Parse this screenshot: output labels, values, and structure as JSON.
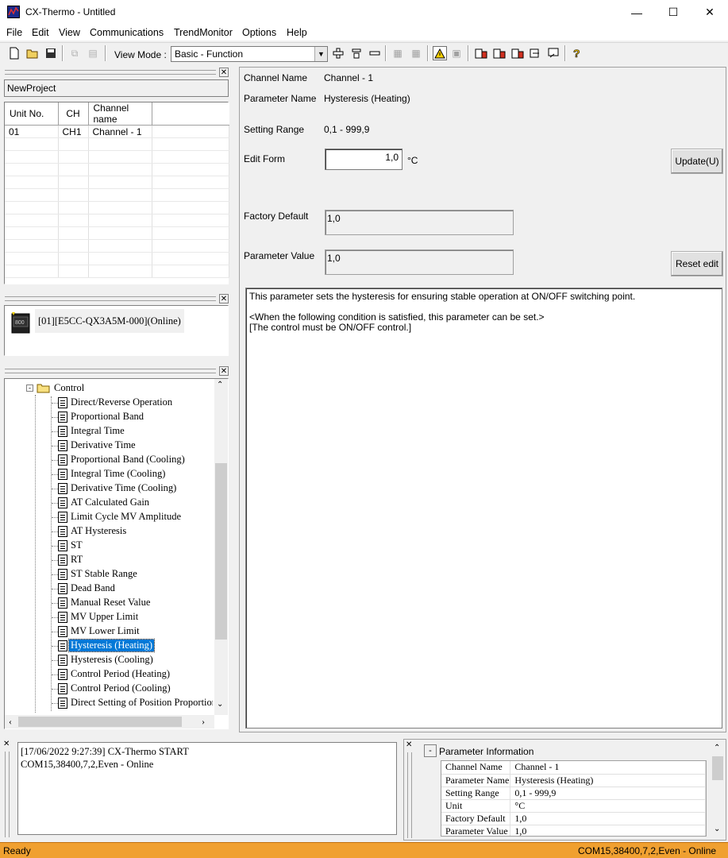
{
  "window": {
    "title": "CX-Thermo - Untitled",
    "minimize": "—",
    "maximize": "☐",
    "close": "✕"
  },
  "menu": [
    "File",
    "Edit",
    "View",
    "Communications",
    "TrendMonitor",
    "Options",
    "Help"
  ],
  "toolbar": {
    "view_mode_label": "View Mode :",
    "view_mode_value": "Basic - Function"
  },
  "project": {
    "name": "NewProject"
  },
  "unit_table": {
    "headers": [
      "Unit No.",
      "CH",
      "Channel name"
    ],
    "rows": [
      [
        "01",
        "CH1",
        "Channel - 1"
      ]
    ]
  },
  "device": {
    "label": "[01][E5CC-QX3A5M-000](Online)",
    "icon_text": "800"
  },
  "tree": {
    "folder": "Control",
    "items": [
      "Direct/Reverse Operation",
      "Proportional Band",
      "Integral Time",
      "Derivative Time",
      "Proportional Band (Cooling)",
      "Integral Time (Cooling)",
      "Derivative Time (Cooling)",
      "AT Calculated Gain",
      "Limit Cycle MV Amplitude",
      "AT Hysteresis",
      "ST",
      "RT",
      "ST Stable Range",
      "Dead Band",
      "Manual Reset Value",
      "MV Upper Limit",
      "MV Lower Limit",
      "Hysteresis (Heating)",
      "Hysteresis (Cooling)",
      "Control Period (Heating)",
      "Control Period (Cooling)",
      "Direct Setting of Position Proportional"
    ],
    "selected_index": 17
  },
  "form": {
    "channel_name_label": "Channel Name",
    "channel_name_value": "Channel - 1",
    "param_name_label": "Parameter Name",
    "param_name_value": "Hysteresis (Heating)",
    "setting_range_label": "Setting Range",
    "setting_range_value": "0,1 - 999,9",
    "edit_form_label": "Edit Form",
    "edit_value": "1,0",
    "unit": "°C",
    "update_button": "Update(U)",
    "factory_default_label": "Factory Default",
    "factory_default_value": "1,0",
    "parameter_value_label": "Parameter Value",
    "parameter_value_value": "1,0",
    "reset_button": "Reset edit"
  },
  "description": {
    "line1": "This parameter sets the hysteresis for ensuring stable operation at ON/OFF switching point.",
    "line2": "<When the following condition is satisfied, this parameter can be set.>",
    "line3": "[The control must be ON/OFF control.]"
  },
  "log": {
    "line1": "[17/06/2022 9:27:39] CX-Thermo START",
    "line2": "COM15,38400,7,2,Even - Online"
  },
  "info": {
    "title": "Parameter Information",
    "collapse": "-",
    "rows": [
      [
        "Channel Name",
        "Channel - 1"
      ],
      [
        "Parameter Name",
        "Hysteresis (Heating)"
      ],
      [
        "Setting Range",
        "0,1 - 999,9"
      ],
      [
        "Unit",
        "°C"
      ],
      [
        "Factory Default",
        "1,0"
      ],
      [
        "Parameter Value",
        "1,0"
      ]
    ]
  },
  "status": {
    "left": "Ready",
    "right": "COM15,38400,7,2,Even - Online"
  }
}
